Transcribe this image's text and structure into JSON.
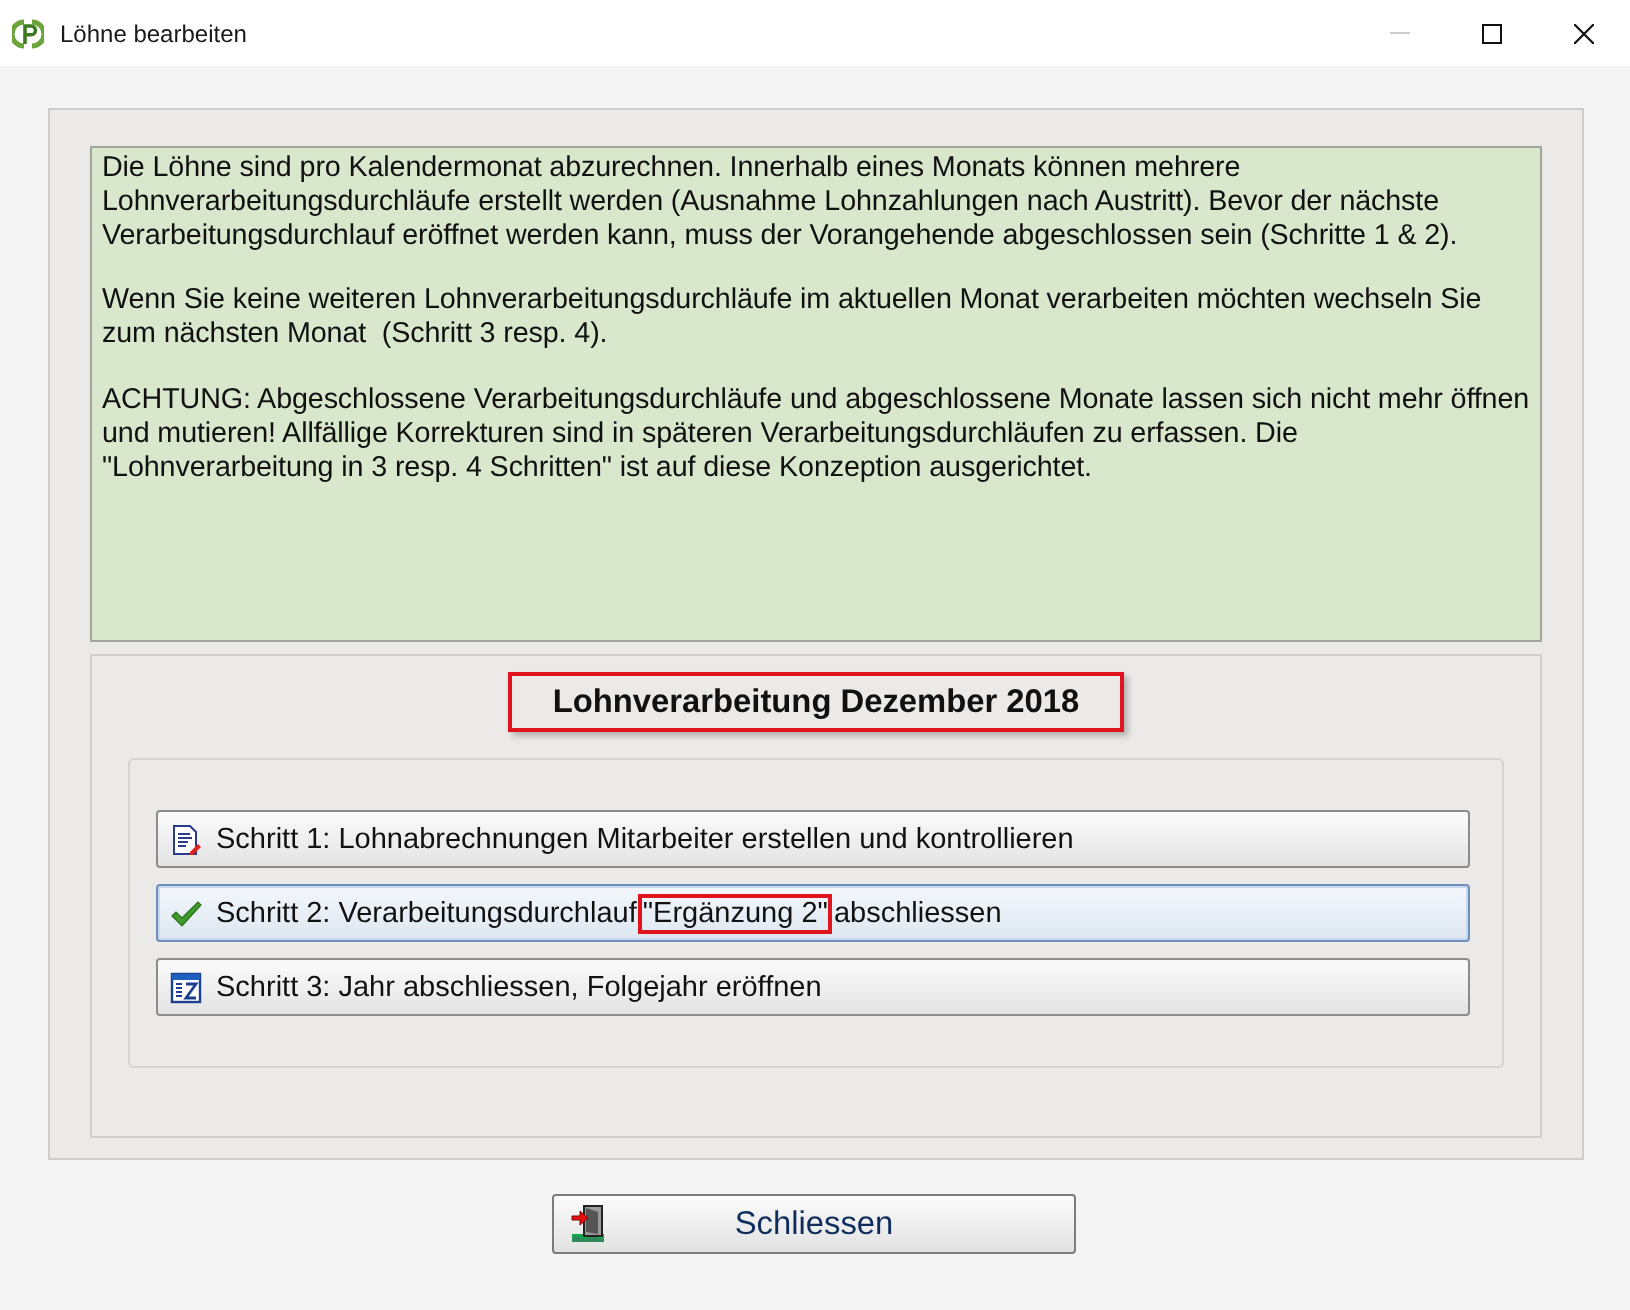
{
  "window": {
    "title": "Löhne bearbeiten",
    "minimize_disabled": true
  },
  "info": {
    "paragraphs": [
      "Die Löhne sind pro Kalendermonat abzurechnen. Innerhalb eines Monats können mehrere Lohnverarbeitungsdurchläufe erstellt werden (Ausnahme Lohnzahlungen nach Austritt). Bevor der nächste Verarbeitungsdurchlauf eröffnet werden kann, muss der Vorangehende abgeschlossen sein (Schritte 1 & 2).",
      "Wenn Sie keine weiteren Lohnverarbeitungsdurchläufe im aktuellen Monat verarbeiten möchten wechseln Sie zum nächsten Monat  (Schritt 3 resp. 4).",
      "ACHTUNG: Abgeschlossene Verarbeitungsdurchläufe und abgeschlossene Monate lassen sich nicht mehr öffnen und mutieren! Allfällige Korrekturen sind in späteren Verarbeitungsdurchläufen zu erfassen. Die \"Lohnverarbeitung in 3 resp. 4 Schritten\" ist auf diese Konzeption ausgerichtet."
    ]
  },
  "month": {
    "title": "Lohnverarbeitung Dezember 2018",
    "highlighted": true
  },
  "steps": [
    {
      "focused": false,
      "label": [
        {
          "text": "Schritt 1: Lohnabrechnungen Mitarbeiter erstellen und kontrollieren",
          "highlighted": false
        }
      ]
    },
    {
      "focused": true,
      "label": [
        {
          "text": "Schritt 2: Verarbeitungsdurchlauf ",
          "highlighted": false
        },
        {
          "text": "\"Ergänzung 2\"",
          "highlighted": true
        },
        {
          "text": " abschliessen",
          "highlighted": false
        }
      ]
    },
    {
      "focused": false,
      "label": [
        {
          "text": "Schritt 3: Jahr abschliessen, Folgejahr eröffnen",
          "highlighted": false
        }
      ]
    }
  ],
  "close_button": {
    "label": "Schliessen"
  }
}
